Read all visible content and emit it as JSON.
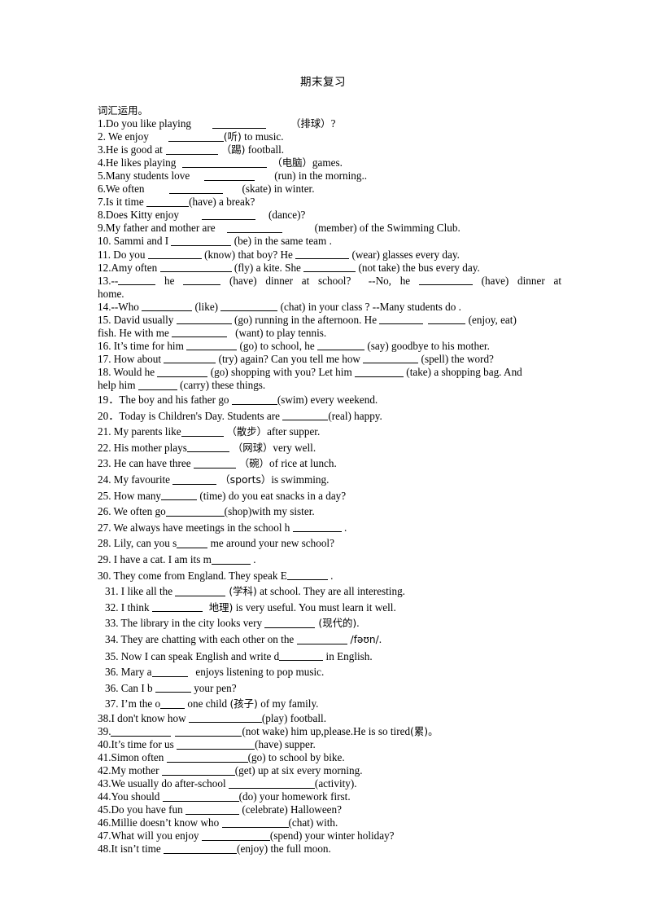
{
  "document": {
    "title": "期末复习",
    "section_heading": "词汇运用。",
    "page_background": "#ffffff",
    "text_color": "#000000"
  },
  "items": [
    {
      "n": "1.",
      "text": "1.Do you like playing",
      "tail": "（排球）?"
    },
    {
      "n": "2.",
      "text": "2. We enjoy",
      "tail": "(听) to music."
    },
    {
      "n": "3.",
      "text": "3.He is good at",
      "tail": "（踢) football."
    },
    {
      "n": "4.",
      "text": "4.He likes playing",
      "tail": "（电脑）games."
    },
    {
      "n": "5.",
      "text": "5.Many students love",
      "tail": "(run) in the morning.."
    },
    {
      "n": "6.",
      "text": "6.We often",
      "tail": "(skate) in winter."
    },
    {
      "n": "7.",
      "text": "7.Is it time",
      "tail": "(have) a break?"
    },
    {
      "n": "8.",
      "text": "8.Does Kitty enjoy",
      "tail": "(dance)?"
    },
    {
      "n": "9.",
      "text": "9.My father and mother are",
      "tail": "(member) of the Swimming Club."
    },
    {
      "n": "10.",
      "text": "10. Sammi and I",
      "tail": "(be) in the same team ."
    },
    {
      "n": "11.",
      "text": "11. Do you",
      "mid": "(know) that boy? He",
      "tail": "(wear) glasses every day."
    },
    {
      "n": "12.",
      "text": "12.Amy often",
      "mid": "(fly) a kite. She",
      "tail": "(not take) the bus every day."
    },
    {
      "n": "13.",
      "text": "13.--",
      "mid": "he",
      "mid2": "(have) dinner at school?",
      "mid3": "--No, he",
      "tail": "(have) dinner at home."
    },
    {
      "n": "14.",
      "text": "14.--Who",
      "mid": "(like)",
      "tail": "(chat) in your class ? --Many students do ."
    },
    {
      "n": "15.",
      "text": "15. David usually",
      "mid": "(go) running in the afternoon. He",
      "mid2": "(enjoy, eat) fish. He with me",
      "tail": "(want) to play tennis."
    },
    {
      "n": "16.",
      "text": "16. It’s time for him",
      "mid": "(go) to school, he",
      "tail": "(say) goodbye to his mother."
    },
    {
      "n": "17.",
      "text": "17. How about",
      "mid": "(try) again? Can you tell me how",
      "tail": "(spell) the word?"
    },
    {
      "n": "18.",
      "text": "18. Would he",
      "mid": "(go) shopping with you? Let him",
      "mid2": "(take) a shopping bag. And help him",
      "tail": "(carry) these things."
    },
    {
      "n": "19.",
      "text": "19．The boy and his father go",
      "tail": "(swim) every weekend."
    },
    {
      "n": "20.",
      "text": "20．Today is Children's Day. Students are",
      "tail": "(real) happy."
    },
    {
      "n": "21.",
      "text": "21. My parents like",
      "tail": "（散步）after supper."
    },
    {
      "n": "22.",
      "text": "22. His mother plays",
      "tail": "（网球）very well."
    },
    {
      "n": "23.",
      "text": "23. He can have three",
      "tail": "（碗）of rice at lunch."
    },
    {
      "n": "24.",
      "text": "24. My favourite",
      "tail": "（sports）is swimming."
    },
    {
      "n": "25.",
      "text": "25. How many",
      "tail": "(time) do you eat snacks in a day?"
    },
    {
      "n": "26.",
      "text": "26. We often go",
      "tail": "(shop)with my sister."
    },
    {
      "n": "27.",
      "text": "27. We always have meetings in the school h",
      "tail": "."
    },
    {
      "n": "28.",
      "text": "28. Lily, can you s",
      "tail": "me around your new school?"
    },
    {
      "n": "29.",
      "text": "29. I have a cat. I am its m",
      "tail": "."
    },
    {
      "n": "30.",
      "text": "30. They come from England. They speak E",
      "tail": "."
    },
    {
      "n": "31.",
      "text": "31. I like all the",
      "tail": "(学科) at school. They are all interesting."
    },
    {
      "n": "32.",
      "text": "32. I think",
      "tail": "地理) is very useful. You must learn it well."
    },
    {
      "n": "33.",
      "text": "33. The library in the city looks very",
      "tail": "(现代的)."
    },
    {
      "n": "34.",
      "text": "34. They are chatting with each other on the",
      "tail": "/fəʊn/."
    },
    {
      "n": "35.",
      "text": "35. Now I can speak English and write d",
      "tail": "in English."
    },
    {
      "n": "36.",
      "text": "36. Mary a",
      "tail": "enjoys listening to pop music."
    },
    {
      "n": "36b.",
      "text": "36. Can I b",
      "tail": "your pen?"
    },
    {
      "n": "37.",
      "text": "37. I’m the o",
      "tail": "one child (孩子) of my family."
    },
    {
      "n": "38.",
      "text": "38.I don't know how",
      "tail": "(play) football."
    },
    {
      "n": "39.",
      "text": "39.",
      "mid": "",
      "tail": "(not wake) him up,please.He is so tired(累)。"
    },
    {
      "n": "40.",
      "text": "40.It’s time for us",
      "tail": "(have) supper."
    },
    {
      "n": "41.",
      "text": "41.Simon often",
      "tail": "(go) to school by bike."
    },
    {
      "n": "42.",
      "text": "42.My mother",
      "tail": "(get) up at six every morning."
    },
    {
      "n": "43.",
      "text": "43.We usually do after-school",
      "tail": "(activity)."
    },
    {
      "n": "44.",
      "text": "44.You should",
      "tail": "(do) your homework first."
    },
    {
      "n": "45.",
      "text": "45.Do you have fun",
      "tail": "(celebrate) Halloween?"
    },
    {
      "n": "46.",
      "text": "46.Millie doesn’t know who",
      "tail": "(chat) with."
    },
    {
      "n": "47.",
      "text": "47.What will you enjoy",
      "tail": "(spend) your winter holiday?"
    },
    {
      "n": "48.",
      "text": "48.It isn’t time",
      "tail": "(enjoy) the full moon."
    }
  ],
  "lines": [
    {
      "id": "q1",
      "pre": "1.Do you like playing",
      "gap": 22,
      "blank": 68,
      "gap2": 26,
      "post": "（排球）?"
    },
    {
      "id": "q2",
      "pre": "2. We enjoy",
      "gap": 22,
      "blank": 68,
      "gap2": 0,
      "post": "(听) to music."
    },
    {
      "id": "q3",
      "pre": "3.He is good at",
      "gap": 6,
      "blank": 68,
      "gap2": 3,
      "post": "（踢) football."
    },
    {
      "id": "q4",
      "pre": "4.He likes playing",
      "gap": 8,
      "blank": 105,
      "gap2": 5,
      "post": "（电脑）games."
    },
    {
      "id": "q5",
      "pre": "5.Many students love",
      "gap": 16,
      "blank": 68,
      "gap2": 22,
      "post": "(run) in the morning.."
    },
    {
      "id": "q6",
      "pre": "6.We often",
      "gap": 26,
      "blank": 68,
      "gap2": 22,
      "post": "(skate) in winter."
    },
    {
      "id": "q7",
      "pre": "7.Is it time",
      "gap": 2,
      "blank": 50,
      "gap2": 0,
      "post": "(have) a break?"
    },
    {
      "id": "q8",
      "pre": "8.Does Kitty enjoy",
      "gap": 26,
      "blank": 68,
      "gap2": 14,
      "post": "(dance)?"
    },
    {
      "id": "q9",
      "pre": "9.My father and mother are",
      "gap": 14,
      "blank": 68,
      "gap2": 38,
      "post": "(member) of the Swimming Club."
    },
    {
      "id": "q10",
      "pre": "10. Sammi and I",
      "gap": 2,
      "blank": 75,
      "gap2": 3,
      "post": "(be) in the same team ."
    },
    {
      "id": "q11a",
      "pre": "11. Do you",
      "gap": 2,
      "blank": 68,
      "gap2": 3,
      "post": "(know) that boy? He"
    },
    {
      "id": "q12a",
      "pre": "12.Amy often",
      "gap": 2,
      "blank": 90,
      "gap2": 3,
      "post": "(fly) a kite. She"
    }
  ],
  "footer": {
    "visible": false
  }
}
